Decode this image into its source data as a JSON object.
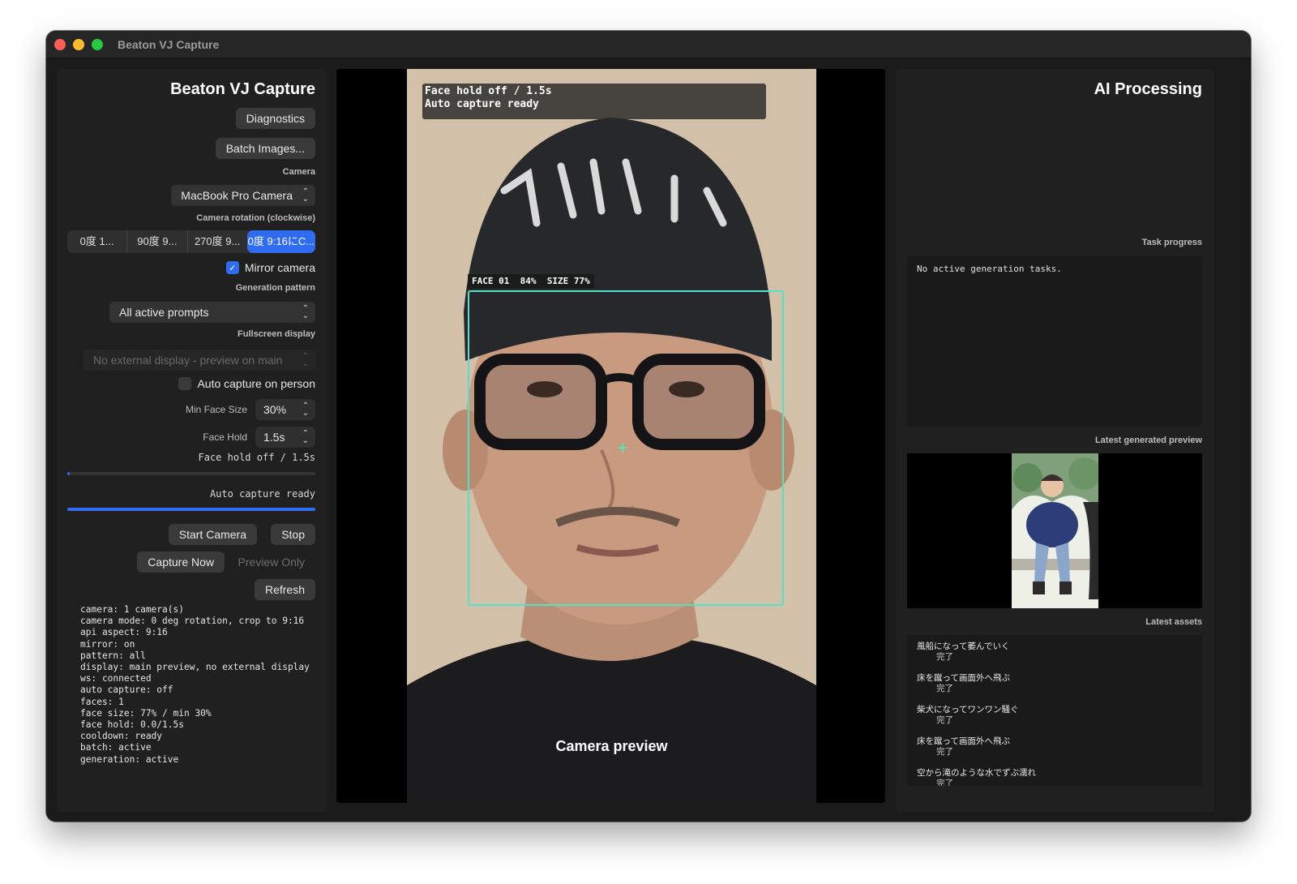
{
  "window": {
    "title": "Beaton VJ Capture"
  },
  "sidebar": {
    "title": "Beaton VJ Capture",
    "diagnostics_label": "Diagnostics",
    "batch_label": "Batch Images...",
    "camera_label": "Camera",
    "camera_value": "MacBook Pro Camera",
    "rotation_label": "Camera rotation (clockwise)",
    "rotation_options": [
      "0度 1...",
      "90度 9...",
      "270度 9...",
      "0度 9:16にC..."
    ],
    "mirror_label": "Mirror camera",
    "mirror_checked": true,
    "pattern_label": "Generation pattern",
    "pattern_value": "All active prompts",
    "fullscreen_label": "Fullscreen display",
    "fullscreen_value": "No external display - preview on main",
    "auto_capture_label": "Auto capture on person",
    "auto_capture_checked": false,
    "min_face_label": "Min Face Size",
    "min_face_value": "30%",
    "face_hold_label": "Face Hold",
    "face_hold_value": "1.5s",
    "face_hold_status": "Face hold off / 1.5s",
    "face_hold_progress": 0.01,
    "auto_capture_status": "Auto capture ready",
    "auto_capture_progress": 1.0,
    "start_label": "Start Camera",
    "stop_label": "Stop",
    "capture_now_label": "Capture Now",
    "preview_only_label": "Preview Only",
    "refresh_label": "Refresh",
    "log": "camera: 1 camera(s)\ncamera mode: 0 deg rotation, crop to 9:16\napi aspect: 9:16\nmirror: on\npattern: all\ndisplay: main preview, no external display\nws: connected\nauto capture: off\nfaces: 1\nface size: 77% / min 30%\nface hold: 0.0/1.5s\ncooldown: ready\nbatch: active\ngeneration: active"
  },
  "preview": {
    "overlay_line1": "Face hold off / 1.5s",
    "overlay_line2": "Auto capture ready",
    "face_tag": "FACE 01  84%  SIZE 77%",
    "caption": "Camera preview"
  },
  "ai": {
    "title": "AI Processing",
    "task_progress_label": "Task progress",
    "task_text": "No active generation tasks.",
    "latest_preview_label": "Latest generated preview",
    "latest_assets_label": "Latest assets",
    "assets": [
      {
        "name": "風船になって萎んでいく",
        "status": "完了"
      },
      {
        "name": "床を蹴って画面外へ飛ぶ",
        "status": "完了"
      },
      {
        "name": "柴犬になってワンワン騒ぐ",
        "status": "完了"
      },
      {
        "name": "床を蹴って画面外へ飛ぶ",
        "status": "完了"
      },
      {
        "name": "空から滝のような水でずぶ濡れ",
        "status": "完了"
      }
    ]
  },
  "colors": {
    "accent": "#2f6cf0",
    "face_box": "#57e0c8",
    "background": "#1b1b1b"
  }
}
